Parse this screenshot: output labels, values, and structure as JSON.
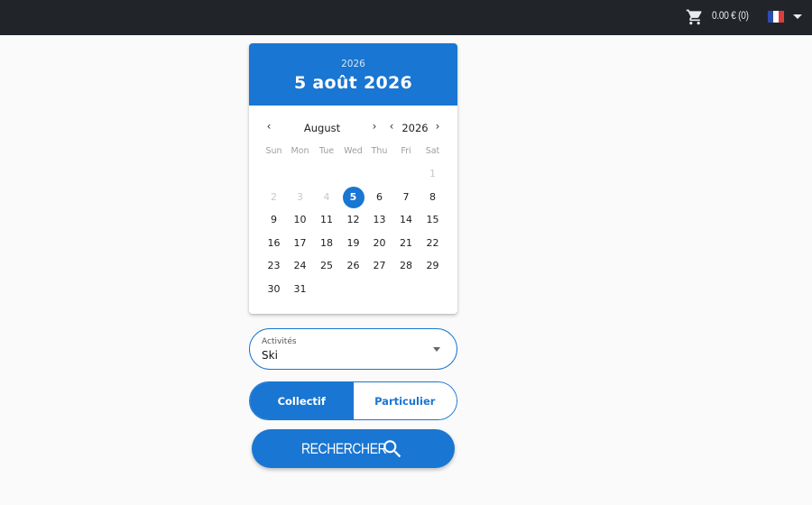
{
  "header": {
    "cart_text": "0.00 € (0)",
    "cart_icon": "shopping-cart-icon",
    "language_flag": "france-flag-icon",
    "colors": {
      "background": "#212529",
      "text": "#e9ecef"
    }
  },
  "date_picker": {
    "header_year": "2026",
    "header_date": "5 août 2026",
    "month_label": "August",
    "year_label": "2026",
    "weekdays": [
      "Sun",
      "Mon",
      "Tue",
      "Wed",
      "Thu",
      "Fri",
      "Sat"
    ],
    "weeks": [
      [
        null,
        null,
        null,
        null,
        null,
        null,
        "1"
      ],
      [
        "2",
        "3",
        "4",
        "5",
        "6",
        "7",
        "8"
      ],
      [
        "9",
        "10",
        "11",
        "12",
        "13",
        "14",
        "15"
      ],
      [
        "16",
        "17",
        "18",
        "19",
        "20",
        "21",
        "22"
      ],
      [
        "23",
        "24",
        "25",
        "26",
        "27",
        "28",
        "29"
      ],
      [
        "30",
        "31",
        null,
        null,
        null,
        null,
        null
      ]
    ],
    "disabled_days": [
      "1",
      "2",
      "3",
      "4"
    ],
    "selected_day": "5",
    "accent_color": "#1976d2"
  },
  "activity_select": {
    "label": "Activités",
    "value": "Ski"
  },
  "lesson_type": {
    "options": [
      "Collectif",
      "Particulier"
    ],
    "selected": "Collectif"
  },
  "search_button": {
    "label": "RECHERCHER",
    "icon": "search-icon"
  }
}
